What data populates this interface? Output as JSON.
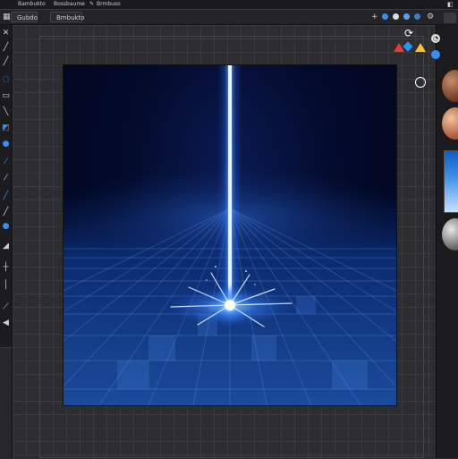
{
  "menubar": {
    "items": [
      "Bambukto",
      "Bossbaume",
      "Brmbuso"
    ]
  },
  "tabs": [
    {
      "label": "Gubdo"
    },
    {
      "label": "Bmbukto"
    }
  ],
  "colors": {
    "accent_blue": "#2f8cff",
    "beam_blue": "#5aa8ff",
    "canvas_dark": "#01041a"
  },
  "toolbar_icons": [
    "close-icon",
    "pencil-icon",
    "brush-icon",
    "lasso-icon",
    "crop-icon",
    "eraser-icon",
    "bucket-icon",
    "sphere-icon",
    "eyedropper-icon",
    "pen-icon",
    "smudge-icon",
    "sphere-icon",
    "triangle-icon",
    "plus-icon",
    "cross-icon",
    "arrow-icon"
  ],
  "artwork": {
    "description_elements": [
      "light-beam",
      "impact-flare",
      "perspective-grid"
    ]
  }
}
